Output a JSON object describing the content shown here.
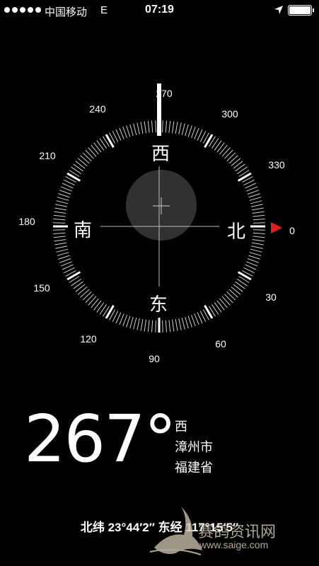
{
  "status_bar": {
    "carrier": "中国移动",
    "network": "E",
    "time": "07:19",
    "signal_bars": 5,
    "icons": [
      "location-arrow-icon",
      "battery-icon"
    ]
  },
  "compass": {
    "cardinals": {
      "west": "西",
      "south": "南",
      "north": "北",
      "east": "东"
    },
    "degrees": {
      "d270": "270",
      "d300": "300",
      "d330": "330",
      "d0": "0",
      "d30": "30",
      "d60": "60",
      "d90": "90",
      "d120": "120",
      "d150": "150",
      "d180": "180",
      "d210": "210",
      "d240": "240"
    },
    "north_marker_color": "#e02020"
  },
  "reading": {
    "heading": "267°",
    "direction": "西",
    "city": "漳州市",
    "province": "福建省",
    "coordinates": "北纬 23°44′2″  东经 117°15′5″"
  },
  "watermark": {
    "name": "赛鸽资讯网",
    "url": "www.saige.com"
  }
}
